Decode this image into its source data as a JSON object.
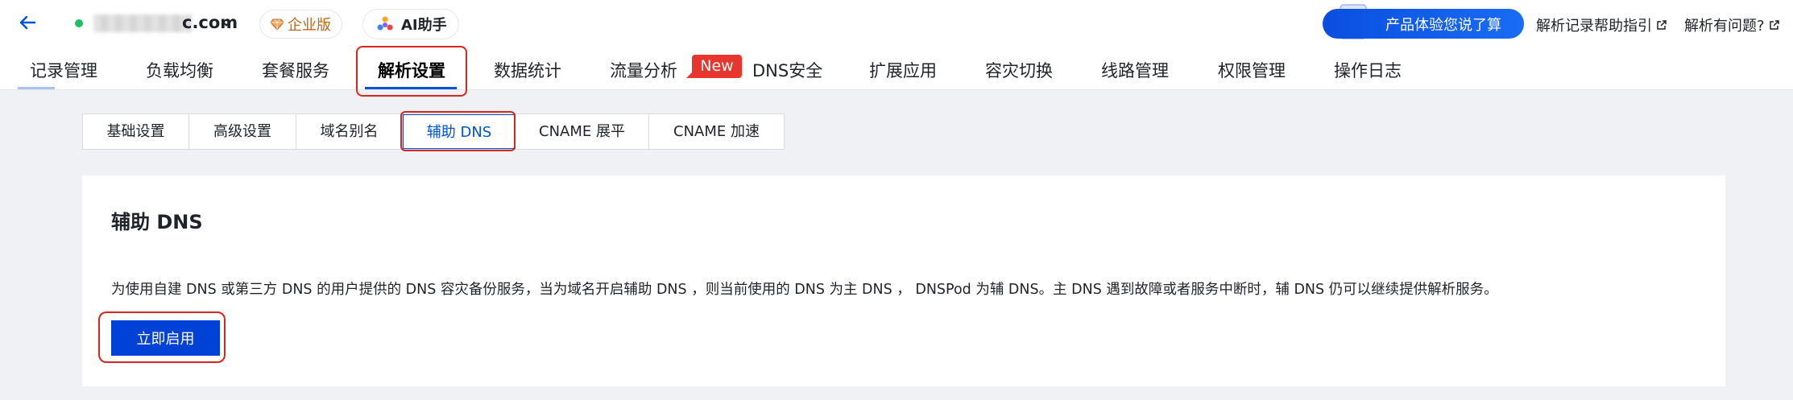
{
  "header": {
    "domain_suffix": "c.com",
    "badge_enterprise": "企业版",
    "badge_ai": "AI助手",
    "promo_text": "产品体验您说了算",
    "help_links": [
      "解析记录帮助指引",
      "解析有问题?"
    ]
  },
  "tabs": [
    {
      "label": "记录管理"
    },
    {
      "label": "负载均衡"
    },
    {
      "label": "套餐服务"
    },
    {
      "label": "解析设置",
      "active": true
    },
    {
      "label": "数据统计"
    },
    {
      "label": "流量分析"
    },
    {
      "label": "DNS安全"
    },
    {
      "label": "扩展应用"
    },
    {
      "label": "容灾切换"
    },
    {
      "label": "线路管理"
    },
    {
      "label": "权限管理"
    },
    {
      "label": "操作日志"
    }
  ],
  "new_badge": "New",
  "subtabs": [
    {
      "label": "基础设置"
    },
    {
      "label": "高级设置"
    },
    {
      "label": "域名别名"
    },
    {
      "label": "辅助 DNS",
      "active": true
    },
    {
      "label": "CNAME 展平"
    },
    {
      "label": "CNAME 加速"
    }
  ],
  "card": {
    "title": "辅助 DNS",
    "description": "为使用自建 DNS 或第三方 DNS 的用户提供的 DNS 容灾备份服务，当为域名开启辅助 DNS ，则当前使用的 DNS 为主 DNS ， DNSPod 为辅 DNS。主 DNS 遇到故障或者服务中断时，辅 DNS 仍可以继续提供解析服务。",
    "button": "立即启用"
  },
  "colors": {
    "accent": "#0052d9",
    "button": "#0041d6",
    "highlight": "#d9261c",
    "status_online": "#1dbf60",
    "new_badge": "#e8362f"
  }
}
